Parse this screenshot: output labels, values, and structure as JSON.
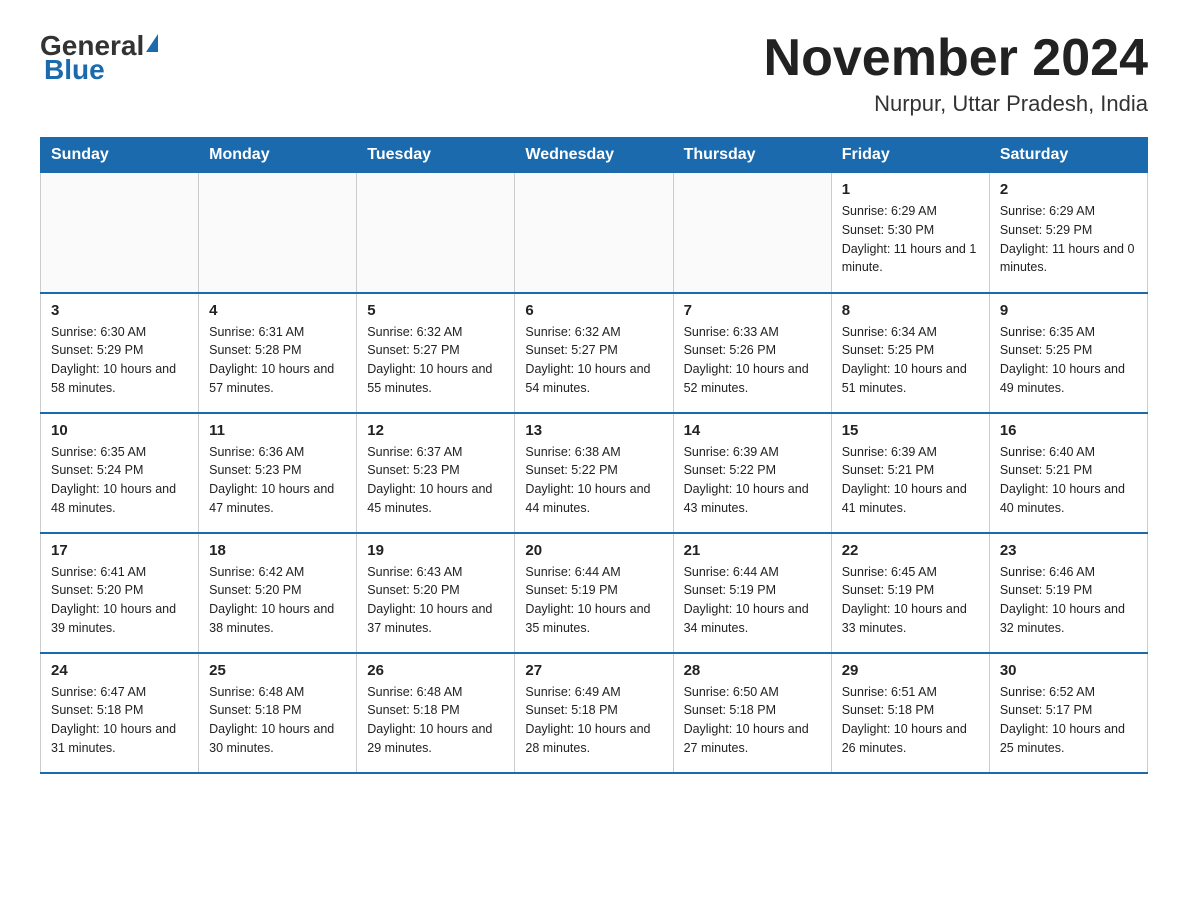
{
  "header": {
    "logo_general": "General",
    "logo_blue": "Blue",
    "month_title": "November 2024",
    "location": "Nurpur, Uttar Pradesh, India"
  },
  "days_of_week": [
    "Sunday",
    "Monday",
    "Tuesday",
    "Wednesday",
    "Thursday",
    "Friday",
    "Saturday"
  ],
  "weeks": [
    [
      {
        "day": "",
        "info": ""
      },
      {
        "day": "",
        "info": ""
      },
      {
        "day": "",
        "info": ""
      },
      {
        "day": "",
        "info": ""
      },
      {
        "day": "",
        "info": ""
      },
      {
        "day": "1",
        "info": "Sunrise: 6:29 AM\nSunset: 5:30 PM\nDaylight: 11 hours and 1 minute."
      },
      {
        "day": "2",
        "info": "Sunrise: 6:29 AM\nSunset: 5:29 PM\nDaylight: 11 hours and 0 minutes."
      }
    ],
    [
      {
        "day": "3",
        "info": "Sunrise: 6:30 AM\nSunset: 5:29 PM\nDaylight: 10 hours and 58 minutes."
      },
      {
        "day": "4",
        "info": "Sunrise: 6:31 AM\nSunset: 5:28 PM\nDaylight: 10 hours and 57 minutes."
      },
      {
        "day": "5",
        "info": "Sunrise: 6:32 AM\nSunset: 5:27 PM\nDaylight: 10 hours and 55 minutes."
      },
      {
        "day": "6",
        "info": "Sunrise: 6:32 AM\nSunset: 5:27 PM\nDaylight: 10 hours and 54 minutes."
      },
      {
        "day": "7",
        "info": "Sunrise: 6:33 AM\nSunset: 5:26 PM\nDaylight: 10 hours and 52 minutes."
      },
      {
        "day": "8",
        "info": "Sunrise: 6:34 AM\nSunset: 5:25 PM\nDaylight: 10 hours and 51 minutes."
      },
      {
        "day": "9",
        "info": "Sunrise: 6:35 AM\nSunset: 5:25 PM\nDaylight: 10 hours and 49 minutes."
      }
    ],
    [
      {
        "day": "10",
        "info": "Sunrise: 6:35 AM\nSunset: 5:24 PM\nDaylight: 10 hours and 48 minutes."
      },
      {
        "day": "11",
        "info": "Sunrise: 6:36 AM\nSunset: 5:23 PM\nDaylight: 10 hours and 47 minutes."
      },
      {
        "day": "12",
        "info": "Sunrise: 6:37 AM\nSunset: 5:23 PM\nDaylight: 10 hours and 45 minutes."
      },
      {
        "day": "13",
        "info": "Sunrise: 6:38 AM\nSunset: 5:22 PM\nDaylight: 10 hours and 44 minutes."
      },
      {
        "day": "14",
        "info": "Sunrise: 6:39 AM\nSunset: 5:22 PM\nDaylight: 10 hours and 43 minutes."
      },
      {
        "day": "15",
        "info": "Sunrise: 6:39 AM\nSunset: 5:21 PM\nDaylight: 10 hours and 41 minutes."
      },
      {
        "day": "16",
        "info": "Sunrise: 6:40 AM\nSunset: 5:21 PM\nDaylight: 10 hours and 40 minutes."
      }
    ],
    [
      {
        "day": "17",
        "info": "Sunrise: 6:41 AM\nSunset: 5:20 PM\nDaylight: 10 hours and 39 minutes."
      },
      {
        "day": "18",
        "info": "Sunrise: 6:42 AM\nSunset: 5:20 PM\nDaylight: 10 hours and 38 minutes."
      },
      {
        "day": "19",
        "info": "Sunrise: 6:43 AM\nSunset: 5:20 PM\nDaylight: 10 hours and 37 minutes."
      },
      {
        "day": "20",
        "info": "Sunrise: 6:44 AM\nSunset: 5:19 PM\nDaylight: 10 hours and 35 minutes."
      },
      {
        "day": "21",
        "info": "Sunrise: 6:44 AM\nSunset: 5:19 PM\nDaylight: 10 hours and 34 minutes."
      },
      {
        "day": "22",
        "info": "Sunrise: 6:45 AM\nSunset: 5:19 PM\nDaylight: 10 hours and 33 minutes."
      },
      {
        "day": "23",
        "info": "Sunrise: 6:46 AM\nSunset: 5:19 PM\nDaylight: 10 hours and 32 minutes."
      }
    ],
    [
      {
        "day": "24",
        "info": "Sunrise: 6:47 AM\nSunset: 5:18 PM\nDaylight: 10 hours and 31 minutes."
      },
      {
        "day": "25",
        "info": "Sunrise: 6:48 AM\nSunset: 5:18 PM\nDaylight: 10 hours and 30 minutes."
      },
      {
        "day": "26",
        "info": "Sunrise: 6:48 AM\nSunset: 5:18 PM\nDaylight: 10 hours and 29 minutes."
      },
      {
        "day": "27",
        "info": "Sunrise: 6:49 AM\nSunset: 5:18 PM\nDaylight: 10 hours and 28 minutes."
      },
      {
        "day": "28",
        "info": "Sunrise: 6:50 AM\nSunset: 5:18 PM\nDaylight: 10 hours and 27 minutes."
      },
      {
        "day": "29",
        "info": "Sunrise: 6:51 AM\nSunset: 5:18 PM\nDaylight: 10 hours and 26 minutes."
      },
      {
        "day": "30",
        "info": "Sunrise: 6:52 AM\nSunset: 5:17 PM\nDaylight: 10 hours and 25 minutes."
      }
    ]
  ]
}
